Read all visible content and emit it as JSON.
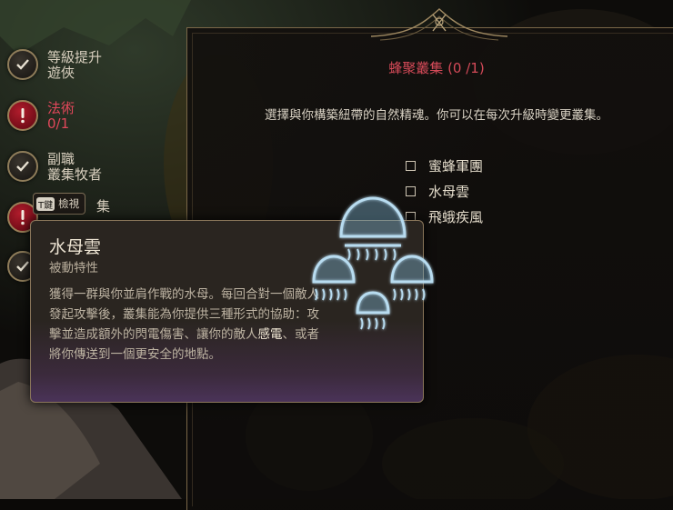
{
  "panel": {
    "title": "蜂聚叢集 (0 /1)",
    "description": "選擇與你構築紐帶的自然精魂。你可以在每次升級時變更叢集。",
    "options": [
      "蜜蜂軍團",
      "水母雲",
      "飛蛾疾風"
    ]
  },
  "steps": [
    {
      "line1": "等級提升",
      "line2": "遊俠",
      "state": "done"
    },
    {
      "line1": "法術",
      "line2": "0/1",
      "state": "warn"
    },
    {
      "line1": "副職",
      "line2": "叢集牧者",
      "state": "done"
    }
  ],
  "keyhint": {
    "key": "T鍵",
    "label": "檢視",
    "trailing": "集"
  },
  "tooltip": {
    "title": "水母雲",
    "subtitle": "被動特性",
    "body_pre": "獲得一群與你並肩作戰的水母。每回合對一個敵人發起攻擊後，叢集能為你提供三種形式的協助：攻擊並造成額外的閃電傷害、讓你的敵人",
    "body_highlight": "感電",
    "body_post": "、或者將你傳送到一個更安全的地點。"
  },
  "colors": {
    "accent_red": "#d44a58",
    "frame_gold": "#8f7d5a",
    "highlight": "#f0e7d4"
  }
}
